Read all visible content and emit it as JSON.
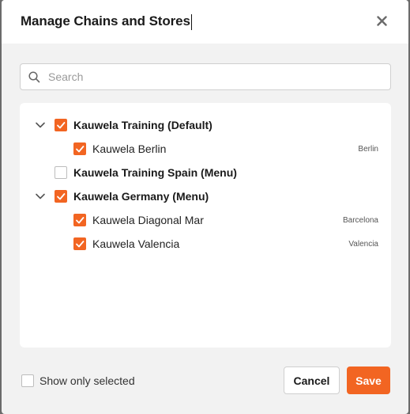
{
  "modal": {
    "title": "Manage Chains and Stores"
  },
  "search": {
    "placeholder": "Search",
    "value": ""
  },
  "tree": [
    {
      "label": "Kauwela Training (Default)",
      "level": 0,
      "expandable": true,
      "checked": true,
      "city": ""
    },
    {
      "label": "Kauwela Berlin",
      "level": 1,
      "expandable": false,
      "checked": true,
      "city": "Berlin"
    },
    {
      "label": "Kauwela Training Spain (Menu)",
      "level": 0,
      "expandable": false,
      "checked": false,
      "city": ""
    },
    {
      "label": "Kauwela Germany (Menu)",
      "level": 0,
      "expandable": true,
      "checked": true,
      "city": ""
    },
    {
      "label": "Kauwela Diagonal Mar",
      "level": 1,
      "expandable": false,
      "checked": true,
      "city": "Barcelona"
    },
    {
      "label": "Kauwela Valencia",
      "level": 1,
      "expandable": false,
      "checked": true,
      "city": "Valencia"
    }
  ],
  "footer": {
    "show_only_selected_label": "Show only selected",
    "show_only_selected_checked": false,
    "cancel_label": "Cancel",
    "save_label": "Save"
  },
  "colors": {
    "accent": "#f26522",
    "panel": "#ffffff",
    "modal_bg": "#f2f2f2"
  },
  "icons": {
    "close": "close-icon",
    "search": "search-icon",
    "expand": "chevron-down-icon",
    "check": "check-icon"
  }
}
